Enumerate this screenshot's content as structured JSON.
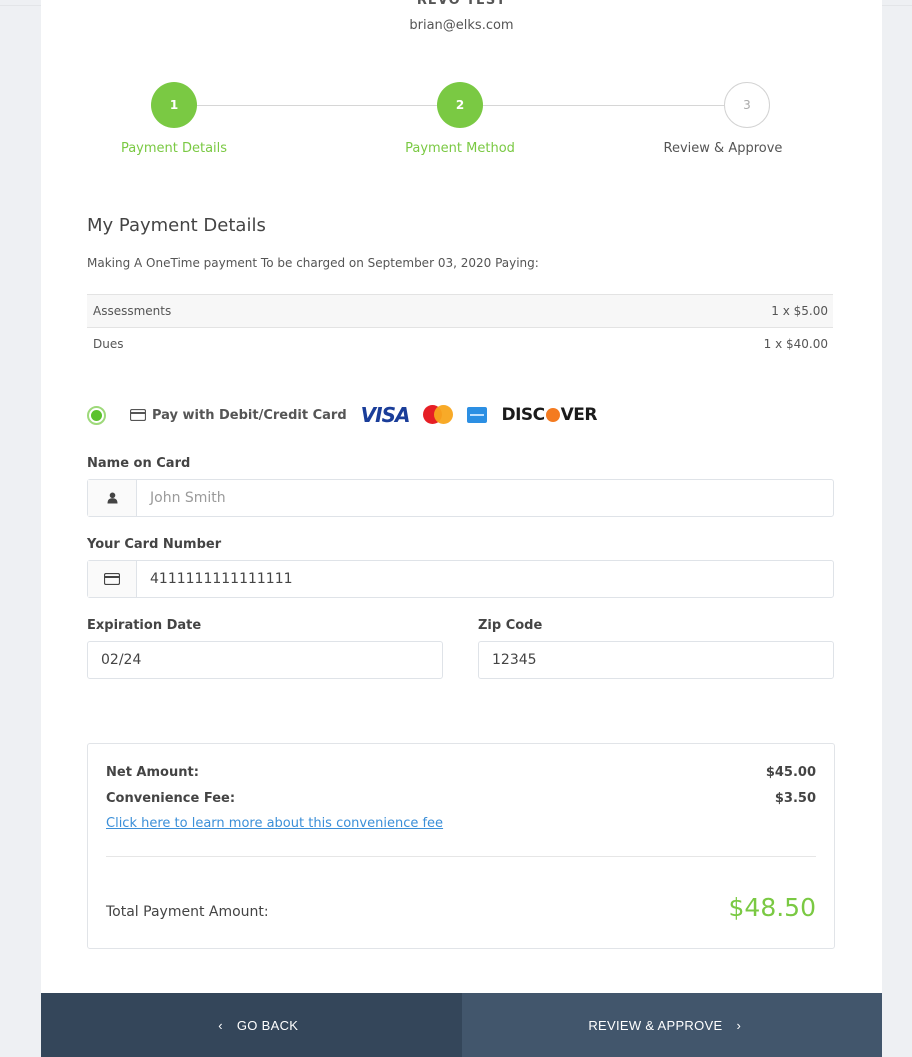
{
  "header": {
    "account_name": "REVO TEST",
    "email": "brian@elks.com"
  },
  "steps": [
    {
      "number": "1",
      "label": "Payment Details",
      "state": "done"
    },
    {
      "number": "2",
      "label": "Payment Method",
      "state": "done"
    },
    {
      "number": "3",
      "label": "Review & Approve",
      "state": "todo"
    }
  ],
  "details": {
    "title": "My Payment Details",
    "subtitle": "Making A OneTime payment To be charged on September 03, 2020 Paying:",
    "items": [
      {
        "name": "Assessments",
        "amount": "1 x $5.00"
      },
      {
        "name": "Dues",
        "amount": "1 x $40.00"
      }
    ]
  },
  "payment_method": {
    "label": "Pay with Debit/Credit Card",
    "brands": [
      "VISA",
      "Mastercard",
      "American Express",
      "DISCOVER"
    ],
    "visa_text": "VISA",
    "discover_pre": "DISC",
    "discover_post": "VER"
  },
  "form": {
    "name_label": "Name on Card",
    "name_placeholder": "John Smith",
    "card_label": "Your Card Number",
    "card_value": "4111111111111111",
    "exp_label": "Expiration Date",
    "exp_value": "02/24",
    "zip_label": "Zip Code",
    "zip_value": "12345"
  },
  "summary": {
    "net_label": "Net Amount:",
    "net_value": "$45.00",
    "fee_label": "Convenience Fee:",
    "fee_value": "$3.50",
    "fee_link": "Click here to learn more about this convenience fee",
    "total_label": "Total Payment Amount:",
    "total_value": "$48.50"
  },
  "footer": {
    "back_label": "GO BACK",
    "next_label": "REVIEW & APPROVE"
  },
  "colors": {
    "accent_green": "#7ac943",
    "footer_dark": "#34465a",
    "footer_light": "#42566c",
    "link_blue": "#3b8fd8"
  },
  "icons": [
    "user-icon",
    "credit-card-icon",
    "chevron-left-icon",
    "chevron-right-icon"
  ]
}
